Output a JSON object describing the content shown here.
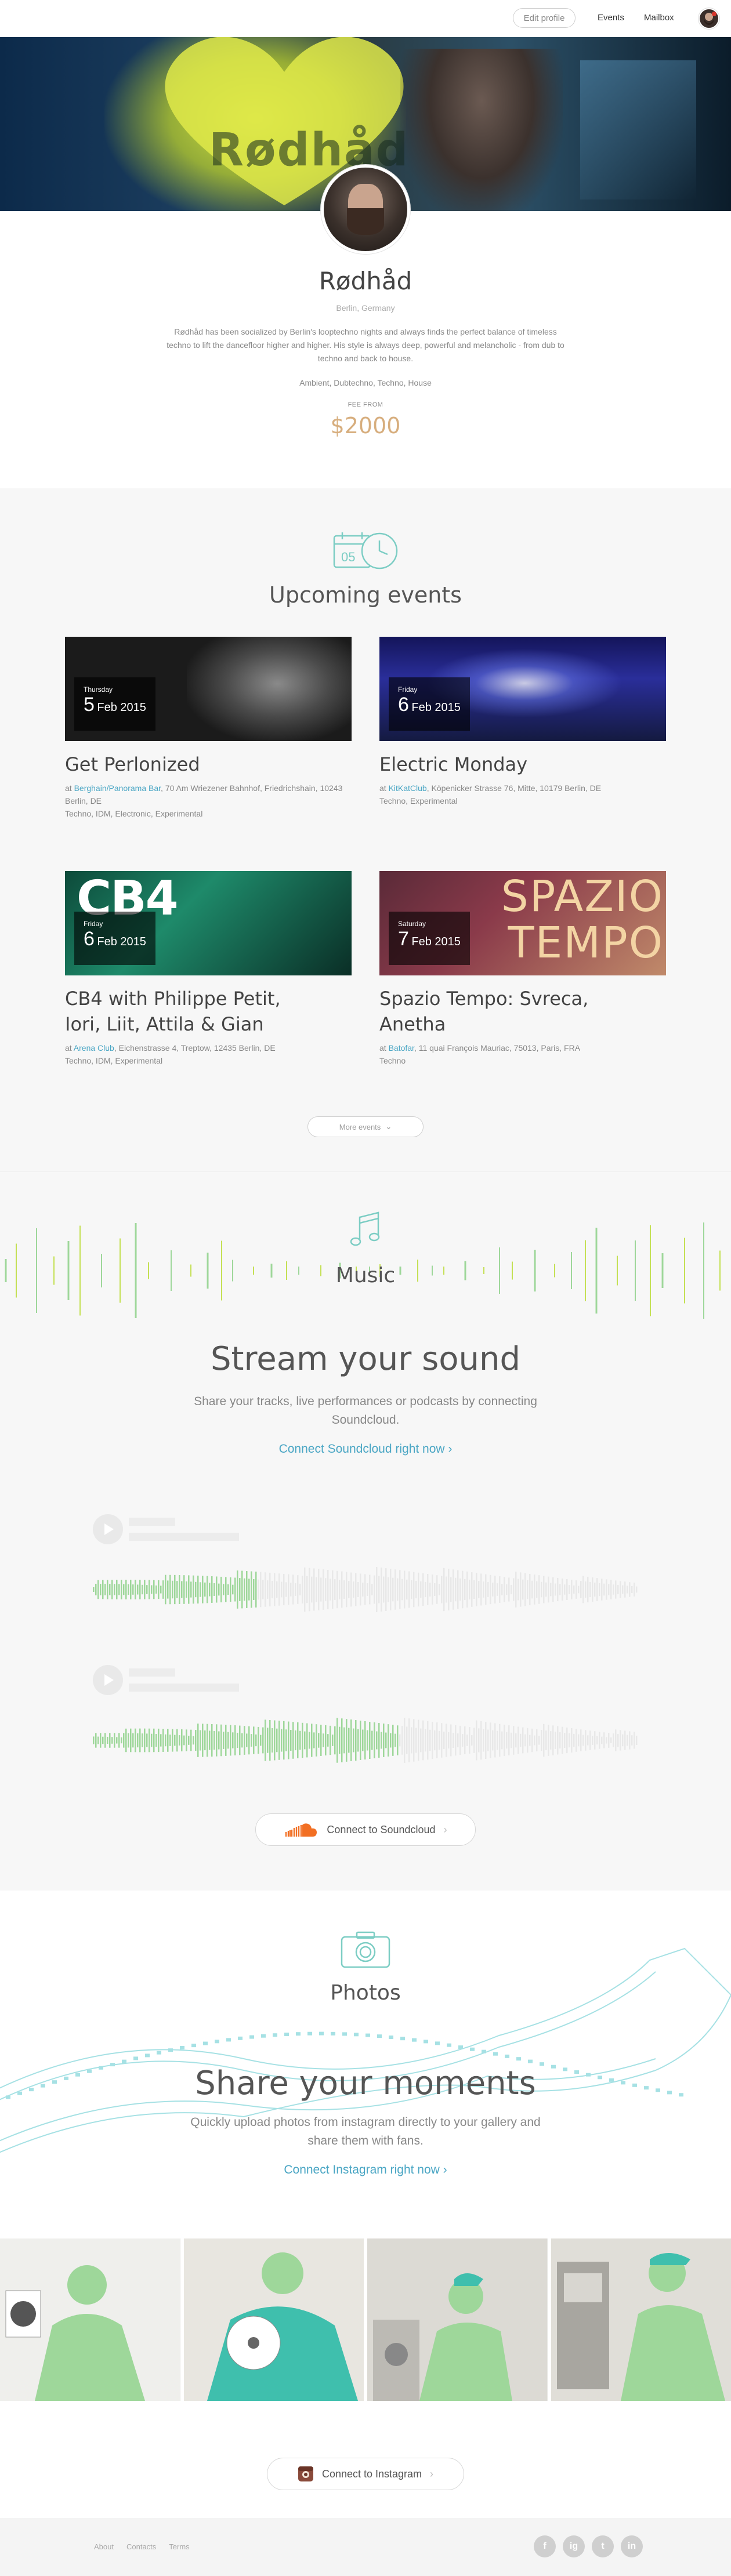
{
  "nav": {
    "edit_profile": "Edit profile",
    "events": "Events",
    "mailbox": "Mailbox"
  },
  "profile": {
    "name": "Rødhåd",
    "banner_logo": "Rødhåd",
    "location": "Berlin, Germany",
    "bio": "Rødhåd has been socialized by Berlin's looptechno nights and always finds the perfect balance of timeless techno to lift the dancefloor higher and higher. His style is always deep, powerful and melancholic - from dub to techno and back to house.",
    "genres": "Ambient, Dubtechno, Techno, House",
    "fee_label": "FEE FROM",
    "fee": "$2000"
  },
  "events": {
    "icon_label": "05",
    "title": "Upcoming events",
    "items": [
      {
        "dow": "Thursday",
        "day": "5",
        "month_year": "Feb 2015",
        "title_lines": [
          "Get Perlonized",
          ""
        ],
        "venue_prefix": "at ",
        "venue": "Berghain/Panorama Bar",
        "address": ", 70 Am Wriezener Bahnhof, Friedrichshain, 10243 Berlin, DE",
        "tags": "Techno, IDM, Electronic, Experimental",
        "thumb_text": ""
      },
      {
        "dow": "Friday",
        "day": "6",
        "month_year": "Feb 2015",
        "title_lines": [
          "Electric Monday",
          ""
        ],
        "venue_prefix": "at ",
        "venue": "KitKatClub",
        "address": ", Köpenicker Strasse 76, Mitte, 10179 Berlin, DE",
        "tags": "Techno, Experimental",
        "thumb_text": ""
      },
      {
        "dow": "Friday",
        "day": "6",
        "month_year": "Feb 2015",
        "title_lines": [
          "CB4 with Philippe Petit,",
          "Iori, Liit, Attila & Gian"
        ],
        "venue_prefix": "at ",
        "venue": "Arena Club",
        "address": ", Eichenstrasse 4, Treptow, 12435 Berlin, DE",
        "tags": "Techno, IDM, Experimental",
        "thumb_text": "CB4"
      },
      {
        "dow": "Saturday",
        "day": "7",
        "month_year": "Feb 2015",
        "title_lines": [
          "Spazio Tempo: Svreca,",
          "Anetha"
        ],
        "venue_prefix": "at ",
        "venue": "Batofar",
        "address": ", 11 quai François Mauriac, 75013, Paris, FRA",
        "tags": "Techno",
        "thumb_text": "SPAZIO TEMPO"
      }
    ],
    "more": "More events"
  },
  "music": {
    "title": "Music",
    "headline": "Stream your sound",
    "text": "Share your tracks, live performances or podcasts by connecting Soundcloud.",
    "connect_link": "Connect Soundcloud right now",
    "tracks": [
      {
        "progress": 0.3
      },
      {
        "progress": 0.56
      }
    ],
    "connect_button": "Connect to Soundcloud"
  },
  "photos": {
    "title": "Photos",
    "headline": "Share your moments",
    "text": "Quickly upload photos from instagram directly to your gallery and share them with fans.",
    "connect_link": "Connect Instagram right now",
    "connect_button": "Connect to Instagram"
  },
  "footer": {
    "links": [
      "About",
      "Contacts",
      "Terms"
    ],
    "social": [
      "f",
      "ig",
      "t",
      "in"
    ]
  },
  "colors": {
    "accent_blue": "#4aa6c4",
    "fee_gold": "#d7ae7e",
    "wave_green": "#9ed79a",
    "wave_lime": "#c4e054",
    "soundcloud_orange": "#f26f23"
  }
}
